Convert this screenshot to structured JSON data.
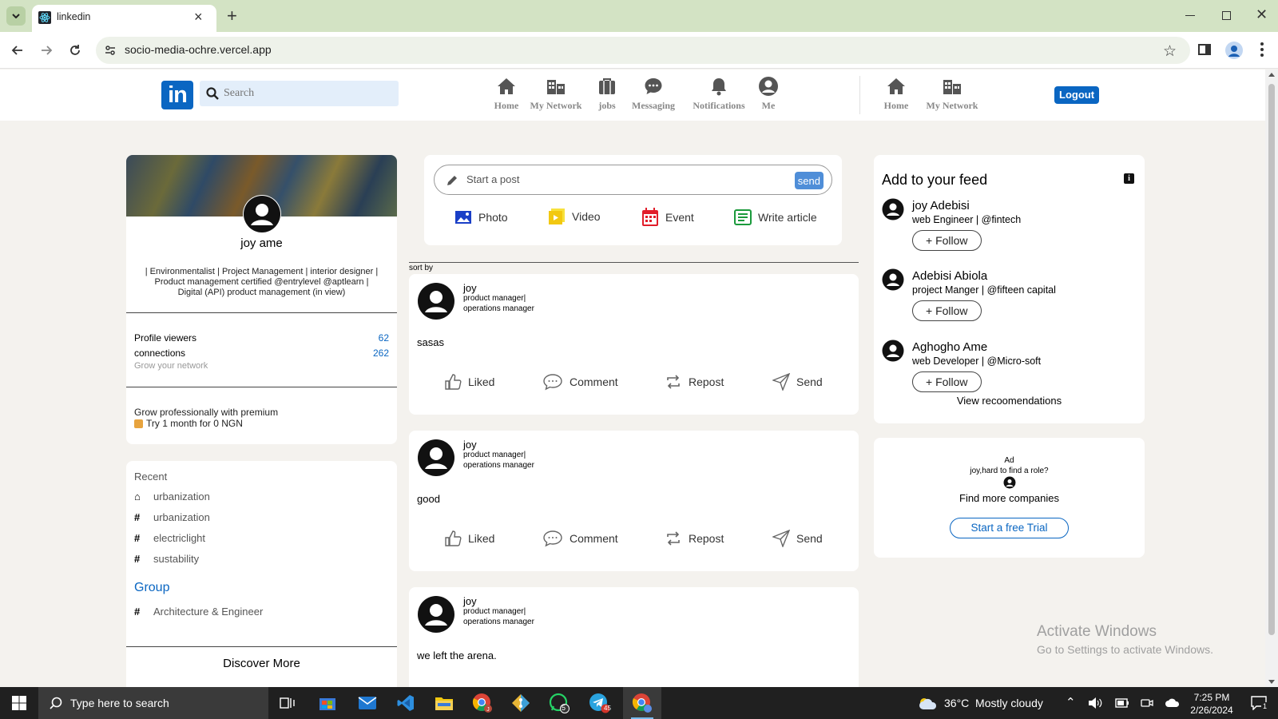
{
  "browser": {
    "tab_title": "linkedin",
    "url": "socio-media-ochre.vercel.app",
    "new_tab_symbol": "+",
    "close_tab_symbol": "×"
  },
  "header": {
    "logo_text": "in",
    "search_placeholder": "Search",
    "nav": [
      {
        "label": "Home",
        "icon": "home-icon"
      },
      {
        "label": "My Network",
        "icon": "network-icon"
      },
      {
        "label": "jobs",
        "icon": "briefcase-icon"
      },
      {
        "label": "Messaging",
        "icon": "message-icon"
      },
      {
        "label": "Notifications",
        "icon": "bell-icon"
      },
      {
        "label": "Me",
        "icon": "user-icon"
      }
    ],
    "nav_secondary": [
      {
        "label": "Home",
        "icon": "home-icon"
      },
      {
        "label": "My Network",
        "icon": "network-icon"
      }
    ],
    "logout_label": "Logout"
  },
  "profile": {
    "name": "joy ame",
    "headline": "| Environmentalist | Project Management | interior designer | Product management certified @entrylevel @aptlearn | Digital (API) product management (in view)",
    "viewers_label": "Profile viewers",
    "viewers_count": "62",
    "connections_label": "connections",
    "connections_count": "262",
    "grow_network": "Grow your network",
    "premium_title": "Grow professionally with premium",
    "premium_offer": "Try 1 month for 0 NGN"
  },
  "recent": {
    "heading": "Recent",
    "items": [
      {
        "symbol": "⌂",
        "label": "urbanization"
      },
      {
        "symbol": "#",
        "label": "urbanization"
      },
      {
        "symbol": "#",
        "label": "electriclight"
      },
      {
        "symbol": "#",
        "label": "sustability"
      }
    ],
    "group_heading": "Group",
    "groups": [
      {
        "symbol": "#",
        "label": "Architecture & Engineer"
      }
    ],
    "discover_more": "Discover More"
  },
  "composer": {
    "placeholder": "Start a post",
    "send_label": "send",
    "photo_label": "Photo",
    "video_label": "Video",
    "event_label": "Event",
    "article_label": "Write article",
    "sort_by": "sort by"
  },
  "posts": [
    {
      "author": "joy",
      "title1": "product manager|",
      "title2": "operations manager",
      "body": "sasas"
    },
    {
      "author": "joy",
      "title1": "product manager|",
      "title2": "operations manager",
      "body": "good"
    },
    {
      "author": "joy",
      "title1": "product manager|",
      "title2": "operations manager",
      "body": "we left the arena."
    }
  ],
  "post_actions": {
    "like": "Liked",
    "comment": "Comment",
    "repost": "Repost",
    "send": "Send"
  },
  "feed": {
    "heading": "Add to your feed",
    "info_symbol": "i",
    "suggestions": [
      {
        "name": "joy Adebisi",
        "role": "web Engineer | @fintech",
        "follow_label": "Follow"
      },
      {
        "name": "Adebisi Abiola",
        "role": "project Manger | @fifteen capital",
        "follow_label": "Follow"
      },
      {
        "name": "Aghogho Ame",
        "role": "web Developer | @Micro-soft",
        "follow_label": "Follow"
      }
    ],
    "view_recommendations": "View recoomendations"
  },
  "ad": {
    "label": "Ad",
    "question": "joy,hard to find a role?",
    "find_companies": "Find more companies",
    "cta": "Start a free Trial"
  },
  "watermark": {
    "line1": "Activate Windows",
    "line2": "Go to Settings to activate Windows."
  },
  "taskbar": {
    "search_placeholder": "Type here to search",
    "whatsapp_badge": "5",
    "telegram_badge": "45",
    "weather": "36°C  Mostly cloudy",
    "time": "7:25 PM",
    "date": "2/26/2024",
    "notification_count": "1"
  },
  "colors": {
    "brand": "#0a66c2",
    "page_bg": "#f4f2ee",
    "tabbar": "#d3e3c4",
    "taskbar": "#202020"
  }
}
